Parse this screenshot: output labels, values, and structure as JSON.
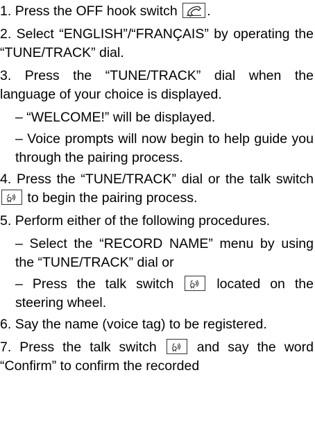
{
  "steps": [
    {
      "num": "1.",
      "text_a": "Press the OFF hook switch",
      "text_b": "."
    },
    {
      "num": "2.",
      "text_a": "Select “ENGLISH”/“FRANÇAIS” by operating the “TUNE/TRACK” dial."
    },
    {
      "num": "3.",
      "text_a": "Press the “TUNE/TRACK” dial when the language of your choice is displayed."
    },
    {
      "num": "",
      "text_a": "– “WELCOME!” will be displayed."
    },
    {
      "num": "",
      "text_a": "– Voice prompts will now begin to help guide you through the pairing process."
    },
    {
      "num": "4.",
      "text_a": "Press the “TUNE/TRACK” dial or the talk switch",
      "text_b": "to begin the pairing process."
    },
    {
      "num": "5.",
      "text_a": "Perform either of the following procedures."
    },
    {
      "num": "",
      "text_a": "– Select the “RECORD NAME” menu by using the “TUNE/TRACK” dial or"
    },
    {
      "num": "",
      "text_a": "– Press the talk switch",
      "text_b": "located on the steering wheel."
    },
    {
      "num": "6.",
      "text_a": "Say the name (voice tag) to be registered."
    },
    {
      "num": "7.",
      "text_a": "Press the talk switch",
      "text_b": "and say the word “Confirm” to confirm the recorded"
    }
  ],
  "icons": {
    "off_hook": "phone-hook-icon",
    "talk": "talk-switch-icon"
  }
}
